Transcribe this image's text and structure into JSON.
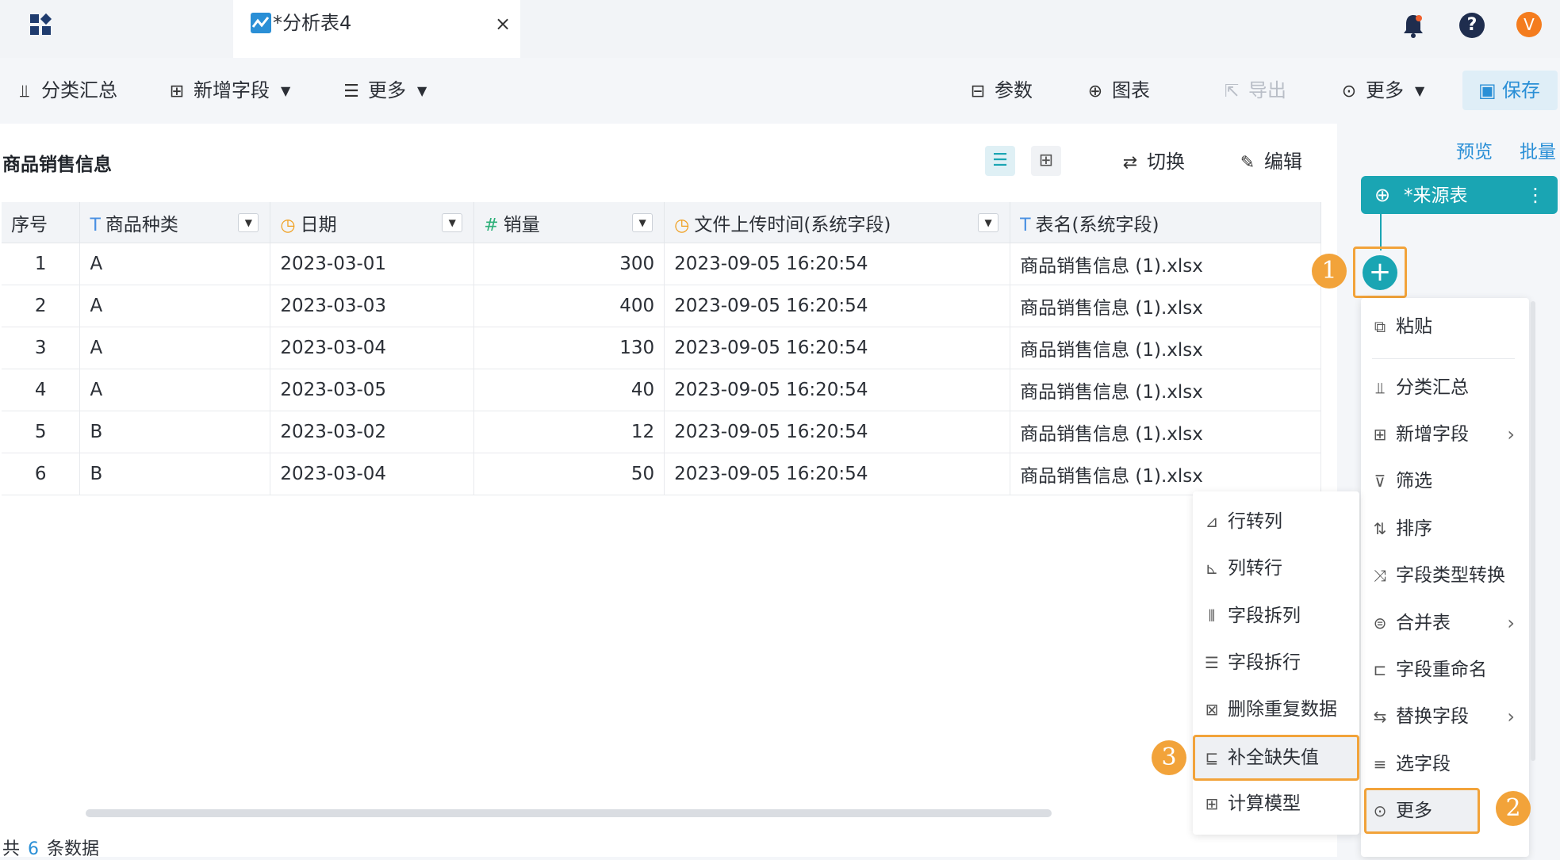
{
  "tab": {
    "title": "*分析表4",
    "close": "×"
  },
  "header_icons": {
    "grid": "apps-grid-icon",
    "bell": "bell-icon",
    "help": "?",
    "avatar": "V",
    "accent": "#f47c1e"
  },
  "toolbar": {
    "group_summary": "分类汇总",
    "add_field": "新增字段",
    "more_left": "更多",
    "params": "参数",
    "chart": "图表",
    "export": "导出",
    "more_right": "更多",
    "save": "保存"
  },
  "section": {
    "title": "商品销售信息",
    "switch": "切换",
    "edit": "编辑"
  },
  "table": {
    "headers": [
      {
        "label": "序号",
        "type": ""
      },
      {
        "label": "商品种类",
        "type": "T"
      },
      {
        "label": "日期",
        "type": "◷"
      },
      {
        "label": "销量",
        "type": "#"
      },
      {
        "label": "文件上传时间(系统字段)",
        "type": "◷"
      },
      {
        "label": "表名(系统字段)",
        "type": "T"
      }
    ],
    "rows": [
      [
        "1",
        "A",
        "2023-03-01",
        "300",
        "2023-09-05 16:20:54",
        "商品销售信息 (1).xlsx"
      ],
      [
        "2",
        "A",
        "2023-03-03",
        "400",
        "2023-09-05 16:20:54",
        "商品销售信息 (1).xlsx"
      ],
      [
        "3",
        "A",
        "2023-03-04",
        "130",
        "2023-09-05 16:20:54",
        "商品销售信息 (1).xlsx"
      ],
      [
        "4",
        "A",
        "2023-03-05",
        "40",
        "2023-09-05 16:20:54",
        "商品销售信息 (1).xlsx"
      ],
      [
        "5",
        "B",
        "2023-03-02",
        "12",
        "2023-09-05 16:20:54",
        "商品销售信息 (1).xlsx"
      ],
      [
        "6",
        "B",
        "2023-03-04",
        "50",
        "2023-09-05 16:20:54",
        "商品销售信息 (1).xlsx"
      ]
    ]
  },
  "footer": {
    "prefix": "共",
    "count": "6",
    "suffix": "条数据"
  },
  "right_panel": {
    "preview": "预览",
    "batch": "批量",
    "source_node": "*来源表",
    "plus": "+"
  },
  "badges": {
    "one": "1",
    "two": "2",
    "three": "3"
  },
  "main_menu": [
    {
      "label": "粘贴",
      "icon": "paste-icon",
      "chevron": false
    },
    {
      "label": "分类汇总",
      "icon": "group-summary-icon",
      "chevron": false
    },
    {
      "label": "新增字段",
      "icon": "add-field-icon",
      "chevron": true
    },
    {
      "label": "筛选",
      "icon": "filter-icon",
      "chevron": false
    },
    {
      "label": "排序",
      "icon": "sort-icon",
      "chevron": false
    },
    {
      "label": "字段类型转换",
      "icon": "type-convert-icon",
      "chevron": false
    },
    {
      "label": "合并表",
      "icon": "merge-table-icon",
      "chevron": true
    },
    {
      "label": "字段重命名",
      "icon": "rename-icon",
      "chevron": false
    },
    {
      "label": "替换字段",
      "icon": "replace-field-icon",
      "chevron": true
    },
    {
      "label": "选字段",
      "icon": "select-field-icon",
      "chevron": false
    },
    {
      "label": "更多",
      "icon": "more-icon",
      "chevron": false
    }
  ],
  "sub_menu": [
    {
      "label": "行转列",
      "icon": "row-to-col-icon"
    },
    {
      "label": "列转行",
      "icon": "col-to-row-icon"
    },
    {
      "label": "字段拆列",
      "icon": "split-col-icon"
    },
    {
      "label": "字段拆行",
      "icon": "split-row-icon"
    },
    {
      "label": "删除重复数据",
      "icon": "dedupe-icon"
    },
    {
      "label": "补全缺失值",
      "icon": "fill-missing-icon"
    },
    {
      "label": "计算模型",
      "icon": "calc-model-icon"
    }
  ],
  "colors": {
    "teal": "#1aa5b3",
    "highlight": "#f2a33a",
    "link": "#2a8fd6"
  }
}
